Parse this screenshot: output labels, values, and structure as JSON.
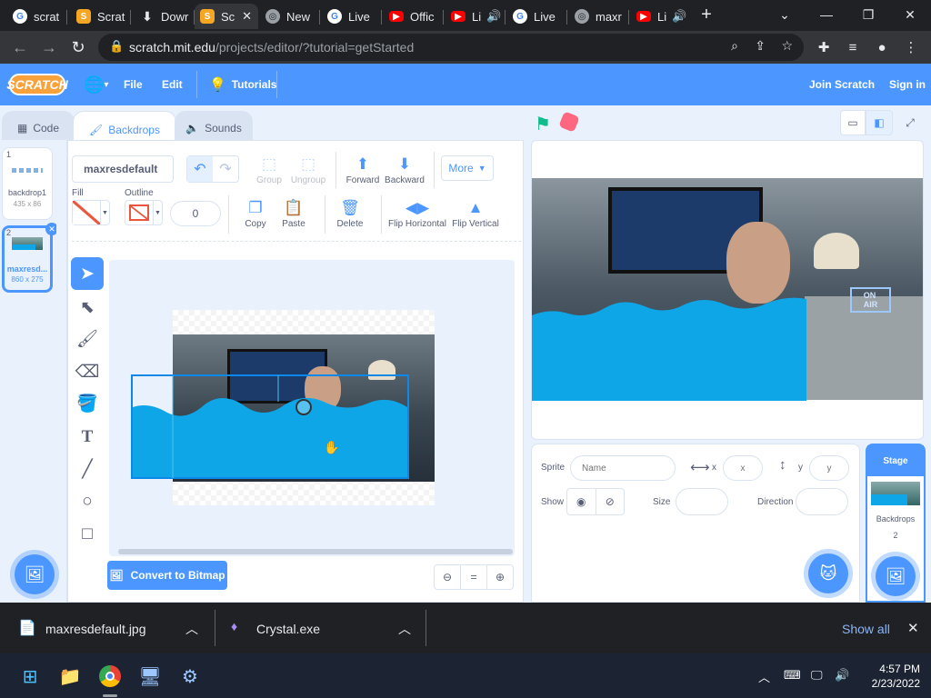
{
  "browser": {
    "tabs": [
      {
        "title": "scrat",
        "icon": "google-icon"
      },
      {
        "title": "Scrat",
        "icon": "scratch-icon"
      },
      {
        "title": "Dowr",
        "icon": "download-icon"
      },
      {
        "title": "Sc",
        "icon": "scratch-icon",
        "active": true
      },
      {
        "title": "New",
        "icon": "globe-icon"
      },
      {
        "title": "Live",
        "icon": "google-icon"
      },
      {
        "title": "Offic",
        "icon": "youtube-icon"
      },
      {
        "title": "Li",
        "icon": "youtube-icon"
      },
      {
        "title": "Live",
        "icon": "google-icon"
      },
      {
        "title": "maxr",
        "icon": "globe-icon"
      },
      {
        "title": "Li",
        "icon": "youtube-icon"
      }
    ],
    "url_host": "scratch.mit.edu",
    "url_path": "/projects/editor/?tutorial=getStarted"
  },
  "menu": {
    "logo": "SCRATCH",
    "file": "File",
    "edit": "Edit",
    "tutorials": "Tutorials",
    "join": "Join Scratch",
    "signin": "Sign in"
  },
  "editor_tabs": {
    "code": "Code",
    "backdrops": "Backdrops",
    "sounds": "Sounds"
  },
  "backdrops": [
    {
      "index": "1",
      "name": "backdrop1",
      "size": "435 x 86"
    },
    {
      "index": "2",
      "name": "maxresd...",
      "size": "860 x 275",
      "selected": true
    }
  ],
  "paint": {
    "costume_name": "maxresdefault",
    "group": "Group",
    "ungroup": "Ungroup",
    "forward": "Forward",
    "backward": "Backward",
    "more": "More",
    "fill_label": "Fill",
    "outline_label": "Outline",
    "outline_width": "0",
    "copy": "Copy",
    "paste": "Paste",
    "delete": "Delete",
    "flip_h": "Flip Horizontal",
    "flip_v": "Flip Vertical",
    "convert": "Convert to Bitmap",
    "zoom_reset": "="
  },
  "sprite_info": {
    "sprite_label": "Sprite",
    "name_placeholder": "Name",
    "x_label": "x",
    "x_placeholder": "x",
    "y_label": "y",
    "y_placeholder": "y",
    "show_label": "Show",
    "size_label": "Size",
    "direction_label": "Direction"
  },
  "stage_selector": {
    "title": "Stage",
    "backdrops_label": "Backdrops",
    "backdrops_count": "2"
  },
  "downloads": [
    {
      "name": "maxresdefault.jpg"
    },
    {
      "name": "Crystal.exe"
    }
  ],
  "downloads_show_all": "Show all",
  "taskbar": {
    "time": "4:57 PM",
    "date": "2/23/2022"
  },
  "colors": {
    "scratch_blue": "#4c97ff",
    "water": "#0fa6e8",
    "chrome_dark": "#202124"
  }
}
